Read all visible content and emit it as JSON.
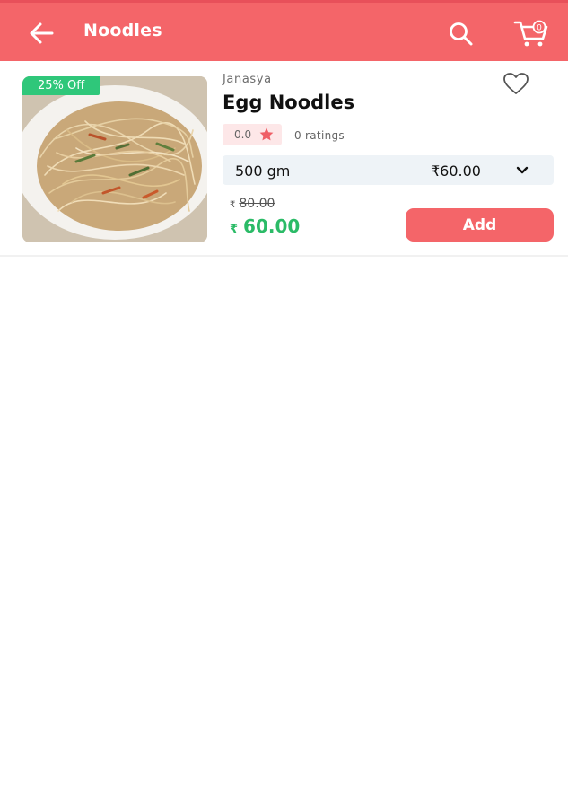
{
  "appbar": {
    "title": "Noodles",
    "back_icon": "arrow-left-icon",
    "search_icon": "search-icon",
    "cart_icon": "cart-icon",
    "cart_count": "0",
    "color": "#f46569"
  },
  "product": {
    "badge": "25% Off",
    "brand": "Janasya",
    "name": "Egg Noodles",
    "rating": "0.0",
    "rating_count": "0 ratings",
    "variant_weight": "500 gm",
    "variant_price": "₹60.00",
    "currency_symbol": "₹",
    "mrp": "80.00",
    "sale_price": "60.00",
    "add_label": "Add",
    "image_icon": "noodles-photo",
    "wishlist_icon": "heart-outline-icon",
    "badge_color": "#2fc77a",
    "price_color": "#2bbb67"
  }
}
